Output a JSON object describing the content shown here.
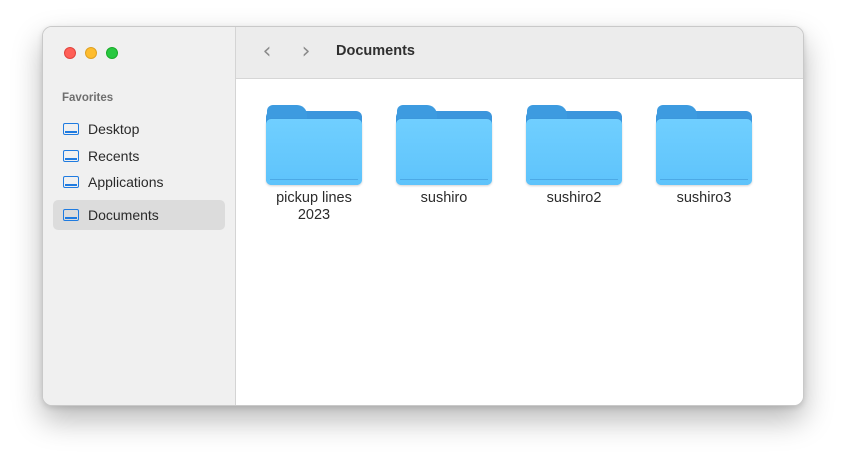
{
  "window": {
    "title": "Documents"
  },
  "sidebar": {
    "section_label": "Favorites",
    "items": [
      {
        "label": "Desktop",
        "icon": "folder-icon"
      },
      {
        "label": "Recents",
        "icon": "folder-icon"
      },
      {
        "label": "Applications",
        "icon": "folder-icon"
      },
      {
        "label": "Documents",
        "icon": "folder-icon",
        "selected": true
      }
    ]
  },
  "toolbar": {
    "back_icon": "chevron-left-icon",
    "forward_icon": "chevron-right-icon"
  },
  "content": {
    "folders": [
      {
        "name": "pickup lines 2023"
      },
      {
        "name": "sushiro"
      },
      {
        "name": "sushiro2"
      },
      {
        "name": "sushiro3"
      }
    ]
  },
  "colors": {
    "close": "#ff5f57",
    "minimize": "#febc2e",
    "zoom": "#28c840",
    "accent": "#1f7be0",
    "folder": "#5ec3fb"
  }
}
